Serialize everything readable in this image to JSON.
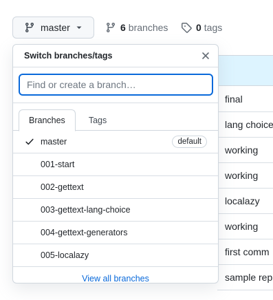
{
  "toolbar": {
    "current_branch": "master",
    "branches_count": "6",
    "branches_label": "branches",
    "tags_count": "0",
    "tags_label": "tags"
  },
  "background_commits": [
    {
      "message": "final"
    },
    {
      "message": "lang choice"
    },
    {
      "message": "working"
    },
    {
      "message": "working"
    },
    {
      "message": "localazy"
    },
    {
      "message": "working"
    },
    {
      "message": "first comm"
    },
    {
      "message": "sample rep"
    }
  ],
  "dropdown": {
    "title": "Switch branches/tags",
    "filter_placeholder": "Find or create a branch…",
    "filter_value": "",
    "tabs": [
      {
        "label": "Branches",
        "active": true
      },
      {
        "label": "Tags",
        "active": false
      }
    ],
    "branches": [
      {
        "name": "master",
        "selected": true,
        "badge": "default"
      },
      {
        "name": "001-start",
        "selected": false,
        "badge": ""
      },
      {
        "name": "002-gettext",
        "selected": false,
        "badge": ""
      },
      {
        "name": "003-gettext-lang-choice",
        "selected": false,
        "badge": ""
      },
      {
        "name": "004-gettext-generators",
        "selected": false,
        "badge": ""
      },
      {
        "name": "005-localazy",
        "selected": false,
        "badge": ""
      }
    ],
    "view_all_label": "View all branches"
  },
  "colors": {
    "accent": "#0969da",
    "text": "#1f2328",
    "muted": "#656d76",
    "border": "#d0d7de",
    "selected_row_bg": "#ddf4ff"
  },
  "icons": {
    "branch": "git-branch-icon",
    "tag": "tag-icon",
    "close": "close-icon",
    "check": "check-icon",
    "caret": "triangle-down-icon"
  }
}
